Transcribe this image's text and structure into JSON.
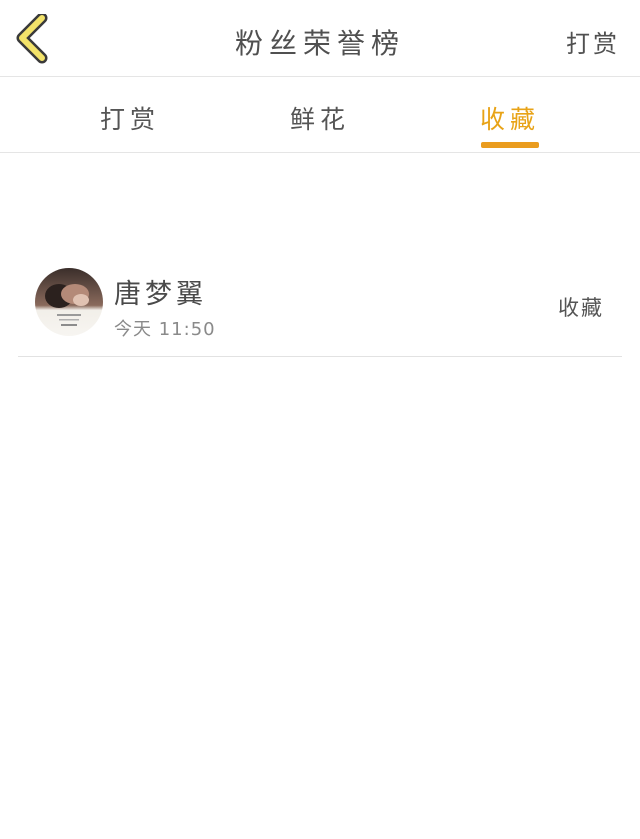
{
  "header": {
    "title": "粉丝荣誉榜",
    "right_action": "打赏"
  },
  "tabs": [
    {
      "label": "打赏",
      "active": false
    },
    {
      "label": "鲜花",
      "active": false
    },
    {
      "label": "收藏",
      "active": true
    }
  ],
  "list": {
    "items": [
      {
        "name": "唐梦翼",
        "time": "今天 11:50",
        "action": "收藏"
      }
    ]
  },
  "colors": {
    "accent": "#ea9c1e",
    "back_icon_fill": "#f3e36a",
    "back_icon_stroke": "#3a3a3a"
  }
}
